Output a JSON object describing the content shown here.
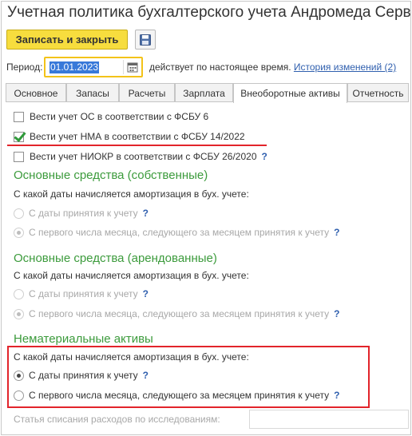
{
  "window": {
    "title": "Учетная политика бухгалтерского учета Андромеда Сервис *"
  },
  "toolbar": {
    "save_close_label": "Записать и закрыть",
    "save_icon": "floppy-disk-icon"
  },
  "period": {
    "label": "Период:",
    "value": "01.01.2023",
    "calendar_icon": "calendar-icon",
    "status_text": "действует по настоящее время.",
    "history_link": "История изменений (2)"
  },
  "tabs": [
    {
      "label": "Основное",
      "active": false
    },
    {
      "label": "Запасы",
      "active": false
    },
    {
      "label": "Расчеты",
      "active": false
    },
    {
      "label": "Зарплата",
      "active": false
    },
    {
      "label": "Внеоборотные активы",
      "active": true
    },
    {
      "label": "Отчетность",
      "active": false
    }
  ],
  "checkboxes": [
    {
      "label": "Вести учет ОС в соответствии с ФСБУ 6",
      "checked": false,
      "help": ""
    },
    {
      "label": "Вести учет НМА в соответствии с ФСБУ 14/2022",
      "checked": true,
      "help": ""
    },
    {
      "label": "Вести учет НИОКР в соответствии с ФСБУ 26/2020",
      "checked": false,
      "help": "?"
    }
  ],
  "sections": {
    "os_own": {
      "title": "Основные средства (собственные)",
      "question": "С какой даты начисляется амортизация в бух. учете:",
      "options": [
        {
          "label": "С даты принятия к учету",
          "help": "?",
          "selected": false
        },
        {
          "label": "С первого числа месяца, следующего за месяцем принятия к учету",
          "help": "?",
          "selected": true
        }
      ]
    },
    "os_leased": {
      "title": "Основные средства (арендованные)",
      "question": "С какой даты начисляется амортизация в бух. учете:",
      "options": [
        {
          "label": "С даты принятия к учету",
          "help": "?",
          "selected": false
        },
        {
          "label": "С первого числа месяца, следующего за месяцем принятия к учету",
          "help": "?",
          "selected": true
        }
      ]
    },
    "nma": {
      "title": "Нематериальные активы",
      "question": "С какой даты начисляется амортизация в бух. учете:",
      "options": [
        {
          "label": "С даты принятия к учету",
          "help": "?",
          "selected": true
        },
        {
          "label": "С первого числа месяца, следующего за месяцем принятия к учету",
          "help": "?",
          "selected": false
        }
      ]
    }
  },
  "research": {
    "label": "Статья списания расходов по исследованиям:",
    "value": ""
  },
  "colors": {
    "accent_button": "#f7dd3e",
    "section_title": "#3c9b3c",
    "link": "#2f5fae",
    "highlight_annotation": "#e2242b"
  }
}
